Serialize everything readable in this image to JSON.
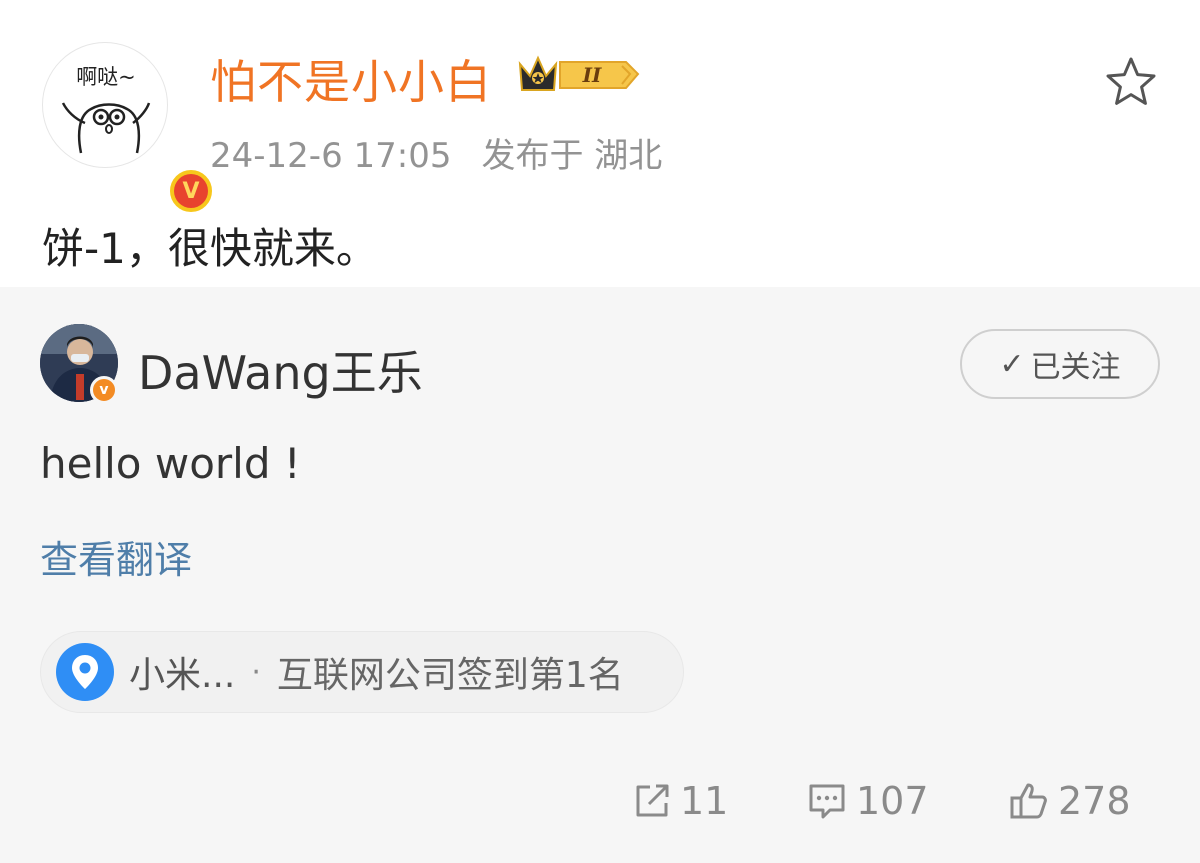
{
  "post": {
    "avatar_caption": "啊哒~",
    "verified_badge": "V",
    "username": "怕不是小小白",
    "member_badge_level": "II",
    "timestamp": "24-12-6 17:05",
    "location": "发布于 湖北",
    "text": "饼-1，很快就来。"
  },
  "repost": {
    "username": "DaWang王乐",
    "verified_badge": "v",
    "follow_check": "✓",
    "follow_label": "已关注",
    "text": "hello world !",
    "translate_label": "查看翻译",
    "checkin": {
      "place": "小米...",
      "separator": "·",
      "rank": "互联网公司签到第1名"
    },
    "stats": {
      "reposts": "11",
      "comments": "107",
      "likes": "278"
    }
  },
  "colors": {
    "username_orange": "#f07424",
    "link_blue": "#4f7ea9",
    "pin_blue": "#2f8ef5",
    "repost_bg": "#f6f6f6"
  },
  "icons": [
    "star-icon",
    "crown-icon",
    "check-icon",
    "location-pin-icon",
    "share-icon",
    "comment-icon",
    "thumbs-up-icon"
  ]
}
